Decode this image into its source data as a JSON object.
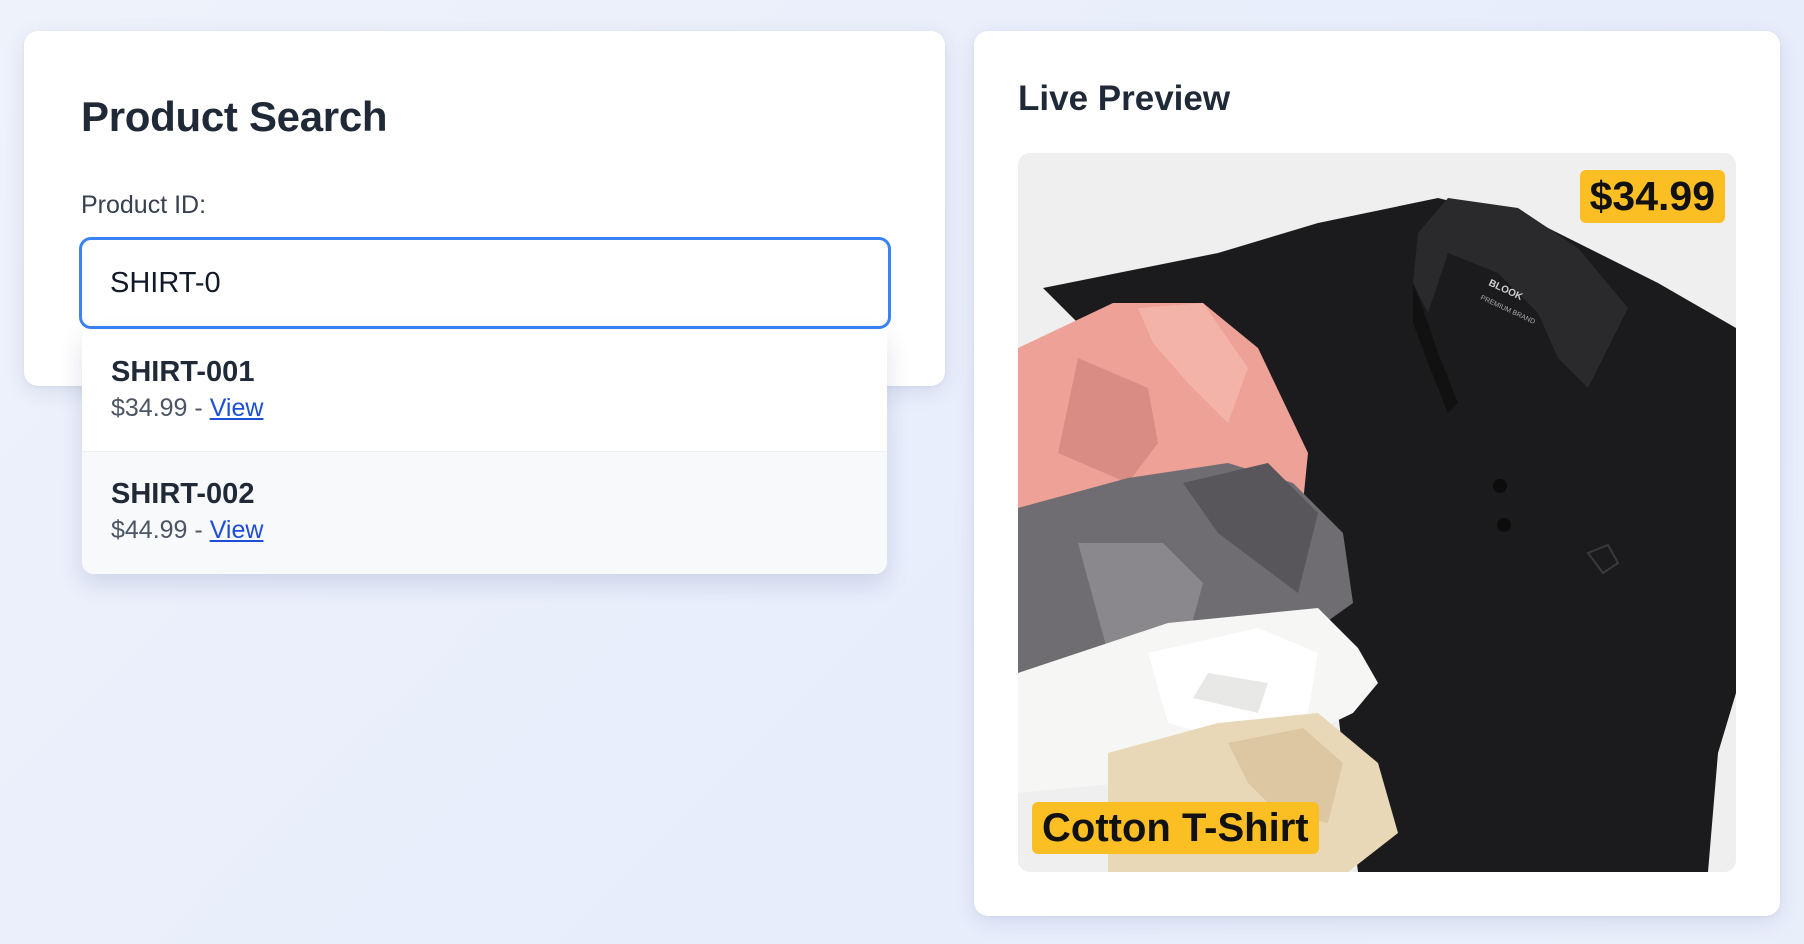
{
  "search_panel": {
    "title": "Product Search",
    "field_label": "Product ID:",
    "input_value": "SHIRT-0",
    "suggestions": [
      {
        "id": "SHIRT-001",
        "price": "$34.99",
        "separator": " - ",
        "link_label": "View"
      },
      {
        "id": "SHIRT-002",
        "price": "$44.99",
        "separator": " - ",
        "link_label": "View"
      }
    ]
  },
  "preview_panel": {
    "title": "Live Preview",
    "price_badge": "$34.99",
    "name_badge": "Cotton T-Shirt",
    "image_label_text": "BLOOK",
    "image_label_subtext": "PREMIUM BRAND"
  },
  "colors": {
    "accent": "#3b82f6",
    "link": "#1d4ed8",
    "badge": "#fbbf24",
    "shirt_pink": "#eda197",
    "shirt_gray": "#6f6d72",
    "shirt_white": "#f6f6f4",
    "shirt_beige": "#e9d8b8",
    "shirt_black": "#1b1b1d"
  }
}
